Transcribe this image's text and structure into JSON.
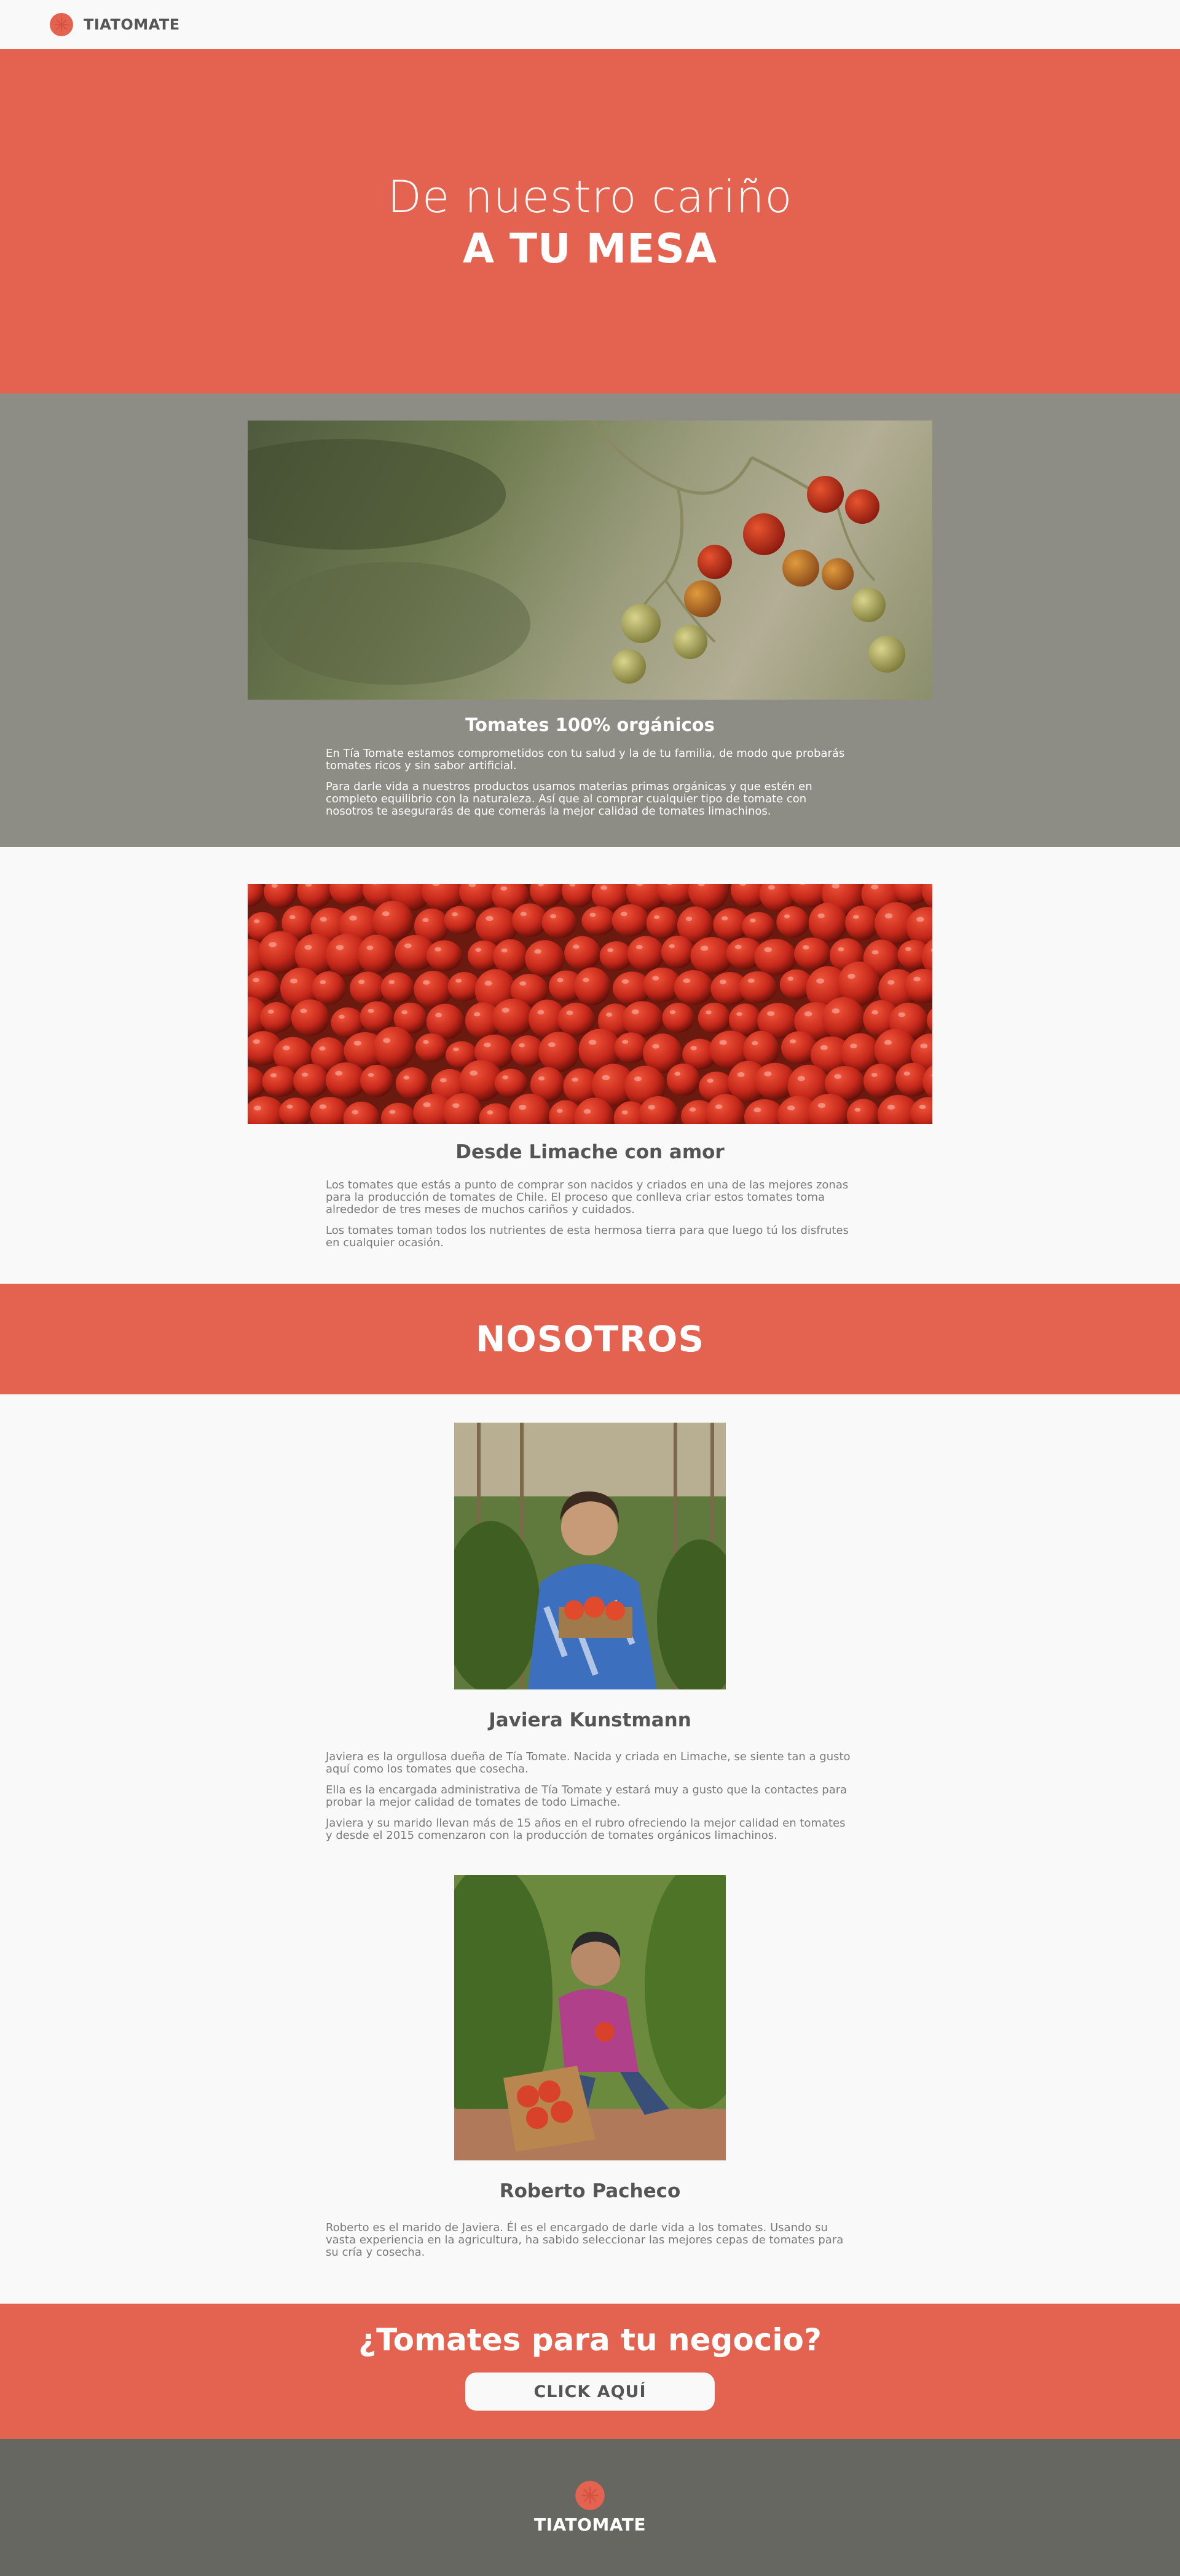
{
  "brand": {
    "name": "TIATOMATE",
    "accent_color": "#e46250",
    "logo_icon": "tomato-icon"
  },
  "hero": {
    "line1": "De nuestro cariño",
    "line2": "A TU MESA"
  },
  "organic": {
    "image_icon": "tomato-vine-photo",
    "title": "Tomates 100% orgánicos",
    "p1": "En Tía Tomate estamos comprometidos con tu salud y la de tu familia, de modo que probarás tomates ricos y sin sabor artificial.",
    "p2": "Para darle vida a nuestros productos usamos materias primas orgánicas y que estén en completo equilibrio con la naturaleza. Así que al comprar cualquier tipo de tomate con nosotros te asegurarás de que comerás la mejor calidad de tomates limachinos."
  },
  "limache": {
    "image_icon": "tomato-pile-photo",
    "title": "Desde Limache con amor",
    "p1": "Los tomates que estás a punto de comprar son nacidos y criados en una de las mejores zonas para la producción de tomates de Chile. El proceso que conlleva criar estos tomates toma alrededor de tres meses de muchos cariños y cuidados.",
    "p2": "Los tomates toman todos los nutrientes de esta hermosa tierra para que luego tú los disfrutes en cualquier ocasión."
  },
  "nosotros": {
    "title": "NOSOTROS"
  },
  "team": [
    {
      "name": "Javiera Kunstmann",
      "photo_icon": "javiera-portrait-photo",
      "paragraphs": [
        "Javiera es la orgullosa dueña de Tía Tomate. Nacida y criada en Limache, se siente tan a gusto aquí como los tomates que cosecha.",
        "Ella es la encargada administrativa de Tía Tomate y estará muy a gusto que la contactes para probar la mejor calidad de tomates de todo Limache.",
        "Javiera y su marido llevan más de 15 años en el rubro ofreciendo la mejor calidad en tomates y desde el 2015 comenzaron con la producción de tomates orgánicos limachinos."
      ]
    },
    {
      "name": "Roberto Pacheco",
      "photo_icon": "roberto-portrait-photo",
      "paragraphs": [
        "Roberto es el marido de Javiera. Él es el encargado de darle vida a los tomates. Usando su vasta experiencia en la agricultura, ha sabido seleccionar las mejores cepas de tomates para su cría y cosecha."
      ]
    }
  ],
  "cta": {
    "title": "¿Tomates para tu negocio?",
    "button_label": "CLICK AQUÍ"
  },
  "footer": {
    "name": "TIATOMATE"
  }
}
